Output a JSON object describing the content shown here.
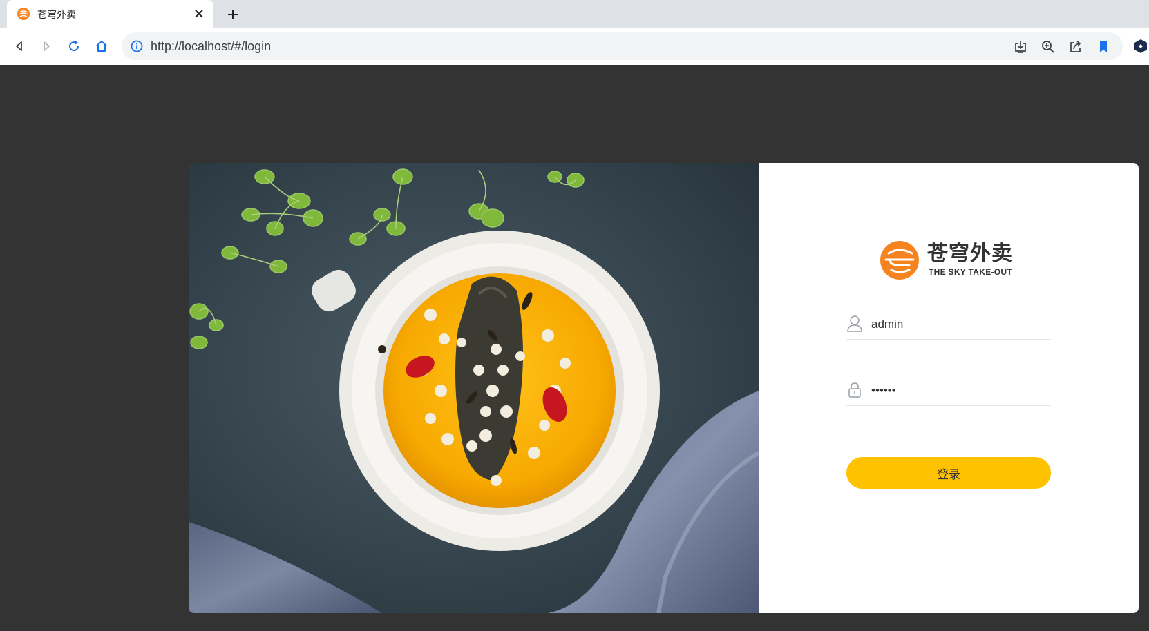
{
  "browser": {
    "tab": {
      "title": "苍穹外卖",
      "favicon": "sky-takeout-favicon"
    },
    "address_bar": {
      "url": "http://localhost/#/login"
    },
    "icons": {
      "back": "back-arrow-icon",
      "forward": "forward-arrow-icon",
      "reload": "reload-icon",
      "home": "home-icon",
      "site_info": "info-icon",
      "install": "install-app-icon",
      "zoom": "zoom-icon",
      "share": "share-icon",
      "bookmark": "bookmark-icon",
      "extension": "extension-icon"
    }
  },
  "login": {
    "logo": {
      "name": "苍穹外卖",
      "subtitle": "THE SKY TAKE-OUT"
    },
    "username": {
      "value": "admin",
      "icon": "user-icon"
    },
    "password": {
      "value": "••••••",
      "icon": "lock-icon"
    },
    "submit_label": "登录"
  },
  "colors": {
    "page_background": "#333333",
    "accent": "#ffc200",
    "logo_orange": "#f58420"
  }
}
